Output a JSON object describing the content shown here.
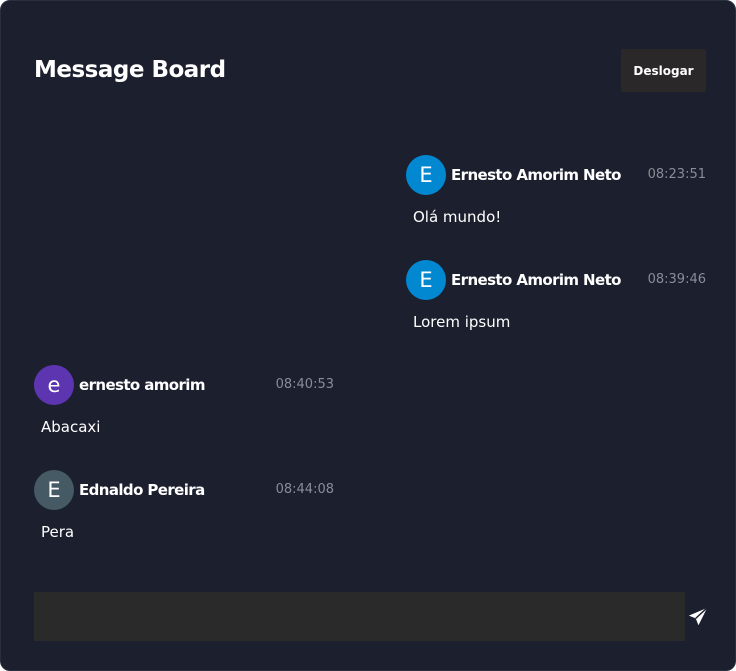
{
  "header": {
    "title": "Message Board",
    "logout_label": "Deslogar"
  },
  "messages": [
    {
      "initial": "E",
      "author": "Ernesto Amorim Neto",
      "time": "08:23:51",
      "text": "Olá mundo!",
      "align": "right",
      "avatar_color": "#0288d1"
    },
    {
      "initial": "E",
      "author": "Ernesto Amorim Neto",
      "time": "08:39:46",
      "text": "Lorem ipsum",
      "align": "right",
      "avatar_color": "#0288d1"
    },
    {
      "initial": "e",
      "author": "ernesto amorim",
      "time": "08:40:53",
      "text": "Abacaxi",
      "align": "left",
      "avatar_color": "#5e35b1"
    },
    {
      "initial": "E",
      "author": "Ednaldo Pereira",
      "time": "08:44:08",
      "text": "Pera",
      "align": "left",
      "avatar_color": "#455a64"
    }
  ],
  "composer": {
    "value": "",
    "placeholder": "",
    "send_icon": "paper-plane-icon"
  },
  "colors": {
    "background": "#1b1f2e",
    "logout_button": "#2a2828",
    "input": "#2b2a2a"
  }
}
